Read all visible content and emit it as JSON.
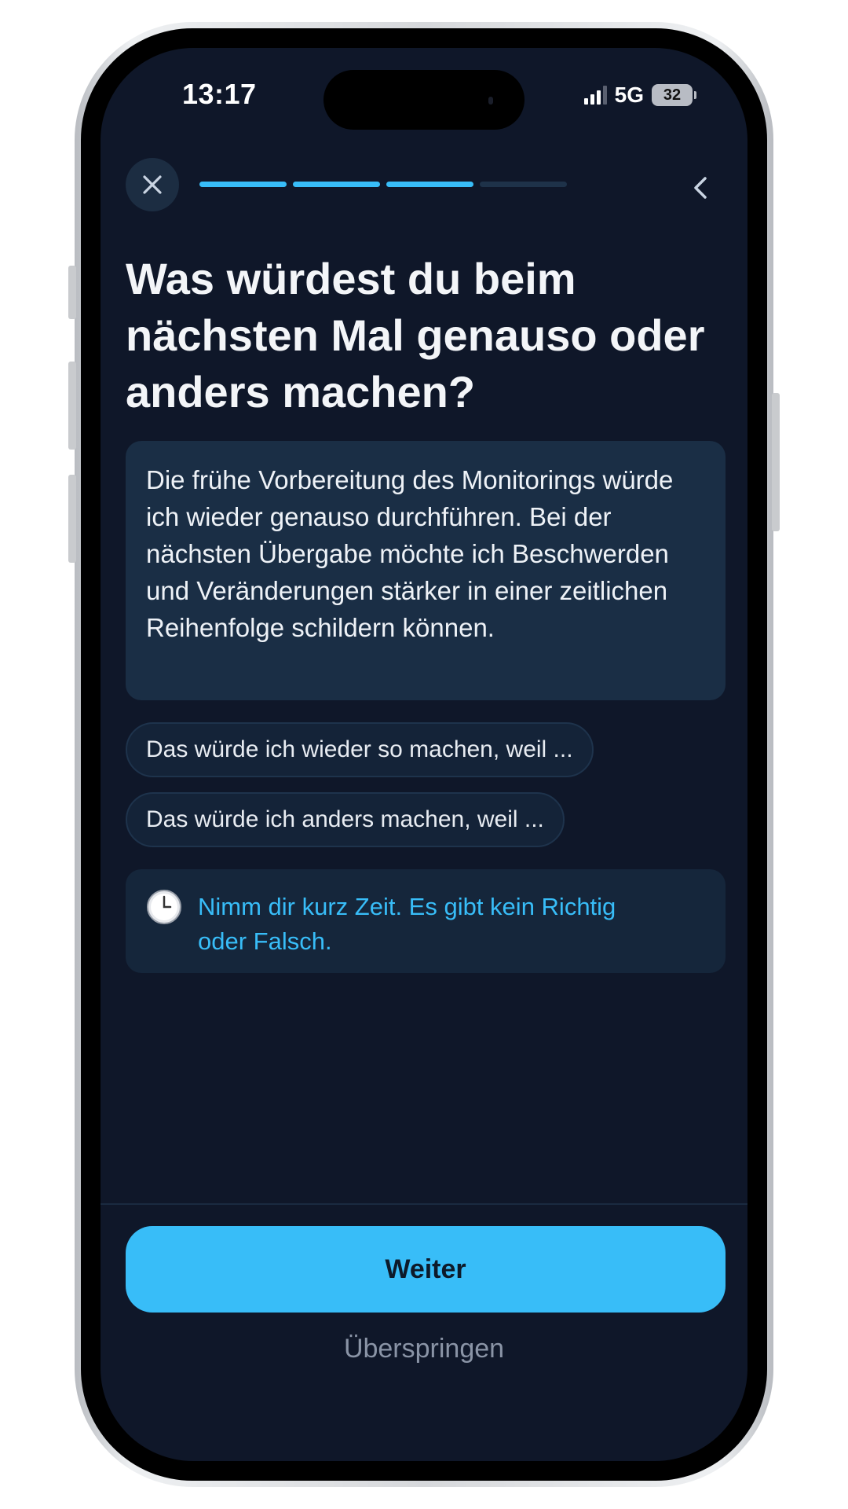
{
  "status_bar": {
    "time": "13:17",
    "network": "5G",
    "battery": "32"
  },
  "header": {
    "close_icon": "close-icon",
    "back_icon": "chevron-left-icon",
    "progress": {
      "current_step": 3,
      "total_steps": 4
    }
  },
  "question": {
    "title": "Was würdest du beim nächsten Mal genauso oder anders machen?"
  },
  "answer": {
    "text": "Die frühe Vorbereitung des Monitorings würde ich wieder genauso durchführen. Bei der nächsten Übergabe möchte ich Beschwerden und Veränderungen stärker in einer zeitlichen Reihenfolge schildern können."
  },
  "suggestions": [
    {
      "label": "Das würde ich wieder so machen, weil ..."
    },
    {
      "label": "Das würde ich anders machen, weil ..."
    }
  ],
  "hint": {
    "icon": "clock-icon",
    "text": "Nimm dir kurz Zeit. Es gibt kein Richtig oder Falsch."
  },
  "footer": {
    "primary_label": "Weiter",
    "skip_label": "Überspringen"
  },
  "colors": {
    "accent": "#38bdf8",
    "background": "#0f1729",
    "card": "#1a2e45"
  }
}
